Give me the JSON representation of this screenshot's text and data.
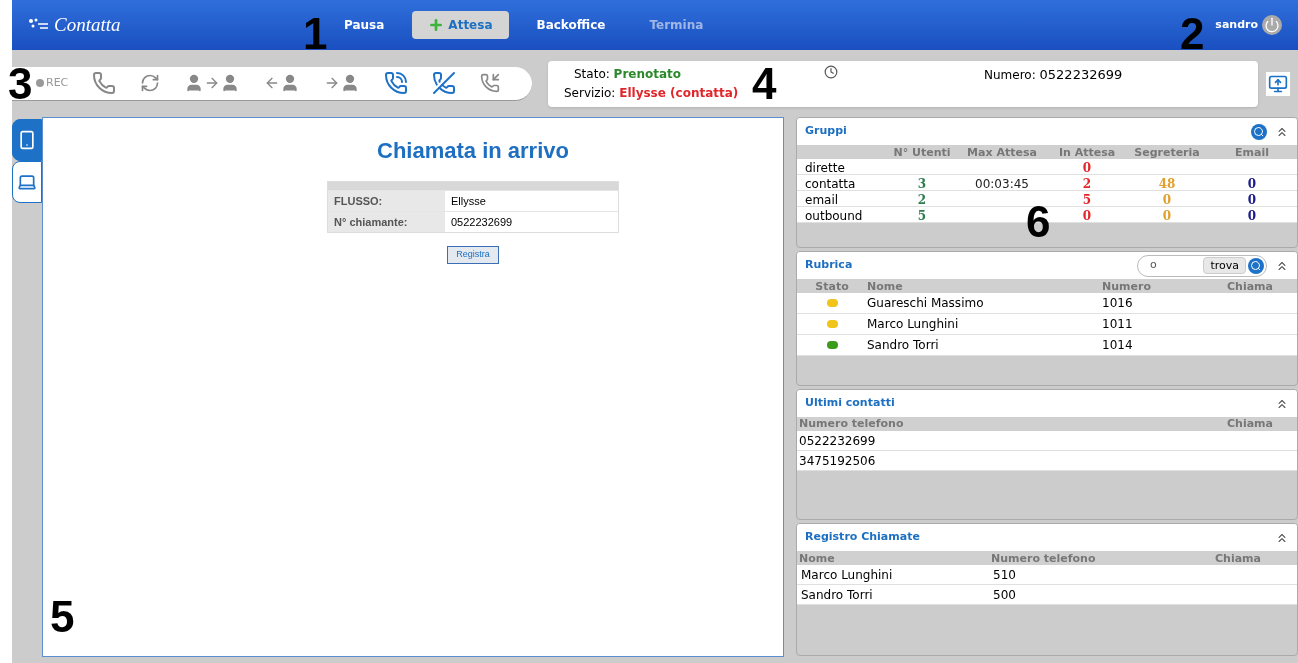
{
  "header": {
    "logo": "Contatta",
    "nav": [
      {
        "label": "Pausa",
        "selected": false,
        "disabled": false,
        "icon": false
      },
      {
        "label": "Attesa",
        "selected": true,
        "disabled": false,
        "icon": true
      },
      {
        "label": "Backoffice",
        "selected": false,
        "disabled": false,
        "icon": false
      },
      {
        "label": "Termina",
        "selected": false,
        "disabled": true,
        "icon": false
      }
    ],
    "user": "sandro"
  },
  "toolbar": {
    "rec": "REC",
    "buttons": [
      {
        "kind": "old-phone",
        "active": false
      },
      {
        "kind": "refresh",
        "active": false
      },
      {
        "kind": "transfer",
        "active": false
      },
      {
        "kind": "pull",
        "active": false
      },
      {
        "kind": "push",
        "active": false
      },
      {
        "kind": "answer",
        "active": true
      },
      {
        "kind": "hangup",
        "active": true
      },
      {
        "kind": "ring",
        "active": false
      }
    ]
  },
  "status": {
    "stato_label": "Stato:",
    "stato": "Prenotato",
    "servizio_label": "Servizio:",
    "servizio": "Ellysse (contatta)",
    "numero_label": "Numero:",
    "numero": "0522232699"
  },
  "side_tabs": [
    {
      "kind": "phone",
      "selected": true
    },
    {
      "kind": "laptop",
      "selected": false
    }
  ],
  "main": {
    "title": "Chiamata in arrivo",
    "fields": [
      {
        "label": "FLUSSO:",
        "value": "Ellysse"
      },
      {
        "label": "N° chiamante:",
        "value": "0522232699"
      }
    ],
    "button": "Registra"
  },
  "gruppi": {
    "title": "Gruppi",
    "columns": [
      {
        "label": "N° Utenti",
        "color": "#2e7d4f"
      },
      {
        "label": "Max Attesa",
        "color": "#222222"
      },
      {
        "label": "In Attesa",
        "color": "#e3262b"
      },
      {
        "label": "Segreteria",
        "color": "#e0a030"
      },
      {
        "label": "Email",
        "color": "#1a1a8c"
      }
    ],
    "rows": [
      {
        "name": "dirette",
        "in_attesa": "0"
      },
      {
        "name": "contatta",
        "utenti": "3",
        "max_attesa": "00:03:45",
        "in_attesa": "2",
        "segreteria": "48",
        "email": "0"
      },
      {
        "name": "email",
        "utenti": "2",
        "in_attesa": "5",
        "segreteria": "0",
        "email": "0"
      },
      {
        "name": "outbound",
        "utenti": "5",
        "in_attesa": "0",
        "segreteria": "0",
        "email": "0"
      }
    ]
  },
  "rubrica": {
    "title": "Rubrica",
    "search_value": "o",
    "search_button": "trova",
    "columns": [
      "Stato",
      "Nome",
      "Numero",
      "Chiama"
    ],
    "rows": [
      {
        "color": "#f0c419",
        "name": "Guareschi Massimo",
        "number": "1016"
      },
      {
        "color": "#f0c419",
        "name": "Marco Lunghini",
        "number": "1011"
      },
      {
        "color": "#3a9a1a",
        "name": "Sandro Torri",
        "number": "1014"
      }
    ]
  },
  "ultimi": {
    "title": "Ultimi contatti",
    "columns": [
      "Numero telefono",
      "Chiama"
    ],
    "rows": [
      "0522232699",
      "3475192506"
    ]
  },
  "registro": {
    "title": "Registro Chiamate",
    "columns": [
      "Nome",
      "Numero telefono",
      "Chiama"
    ],
    "rows": [
      [
        "Marco Lunghini",
        "510"
      ],
      [
        "Sandro Torri",
        "500"
      ]
    ]
  },
  "callouts": [
    "1",
    "2",
    "3",
    "4",
    "5",
    "6"
  ]
}
